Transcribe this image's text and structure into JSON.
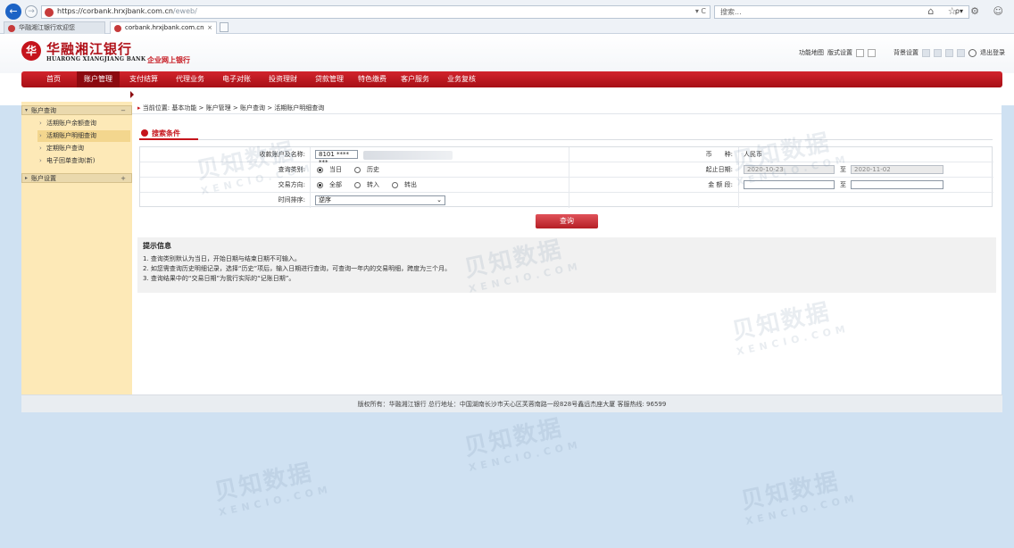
{
  "browser": {
    "url_main": "https://corbank.hrxjbank.com.cn",
    "url_path": "/eweb/",
    "address_tools": "▾ C",
    "search_placeholder": "搜索...",
    "search_icon": "ρ▾",
    "tabs": [
      {
        "label": "华融湘江银行欢迎您",
        "close": ""
      },
      {
        "label": "corbank.hrxjbank.com.cn",
        "close": "×"
      }
    ],
    "icons": "⌂ ☆ ⚙ ☺"
  },
  "header": {
    "logo_mark": "华",
    "logo_cn": "华融湘江银行",
    "logo_en": "HUARONG XIANGJIANG BANK",
    "subtitle": "企业网上银行",
    "link_map": "功能地图",
    "link_layout": "版式设置",
    "link_bg": "背景设置",
    "link_logout": "退出登录"
  },
  "menu": [
    {
      "label": "首页"
    },
    {
      "label": "账户管理"
    },
    {
      "label": "支付结算"
    },
    {
      "label": "代理业务"
    },
    {
      "label": "电子对账"
    },
    {
      "label": "投资理财"
    },
    {
      "label": "贷款管理"
    },
    {
      "label": "特色缴费"
    },
    {
      "label": "客户服务"
    },
    {
      "label": "业务复核"
    }
  ],
  "sidebar": {
    "group1": "账户查询",
    "group1_toggle": "−",
    "items": [
      {
        "label": "活期账户余额查询"
      },
      {
        "label": "活期账户明细查询"
      },
      {
        "label": "定期账户查询"
      },
      {
        "label": "电子回单查询(新)"
      }
    ],
    "group2": "账户设置",
    "group2_toggle": "+"
  },
  "breadcrumb": "当前位置: 基本功能 > 账户管理 > 账户查询 > 活期账户明细查询",
  "section_title": "搜索条件",
  "form": {
    "account_label": "收款账户及名称:",
    "account_value": "8101 **** ***",
    "currency_label": "币　　种:",
    "currency_value": "人民币",
    "query_type_label": "查询类别:",
    "opt_today": "当日",
    "opt_history": "历史",
    "date_label": "起止日期:",
    "date_start": "2020-10-23",
    "date_to": "至",
    "date_end": "2020-11-02",
    "direction_label": "交易方向:",
    "opt_all": "全部",
    "opt_in": "转入",
    "opt_out": "转出",
    "amount_label": "金 额 段:",
    "amount_to": "至",
    "sort_label": "时间排序:",
    "sort_value": "逆序",
    "sort_chevron": "⌄"
  },
  "query_button": "查询",
  "tips": {
    "title": "提示信息",
    "lines": [
      "1. 查询类别默认为当日，开始日期与结束日期不可输入。",
      "2. 如您需查询历史明细记录，选择“历史”项后，输入日期进行查询，可查询一年内的交易明细，跨度为三个月。",
      "3. 查询结果中的“交易日期”为我行实际的“记账日期”。"
    ]
  },
  "footer": "版权所有：华融湘江银行 总行地址：中国湖南长沙市天心区芙蓉南路一段828号鑫远杰座大厦 客服热线: 96599",
  "watermark": {
    "cn": "贝知数据",
    "en": "XENCIO.COM"
  }
}
